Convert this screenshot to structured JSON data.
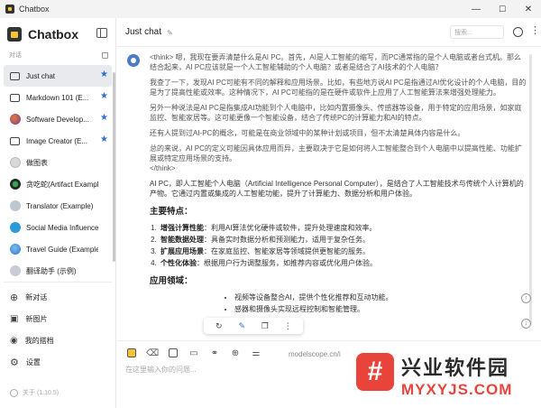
{
  "window": {
    "title": "Chatbox",
    "minimize": "—",
    "maximize": "☐",
    "close": "✕"
  },
  "sidebar": {
    "brand": "Chatbox",
    "section_label": "对话",
    "chats": [
      {
        "label": "Just chat",
        "starred": true,
        "icon": "chat-bubble-icon"
      },
      {
        "label": "Markdown 101 (E...",
        "starred": true,
        "icon": "chat-bubble-icon"
      },
      {
        "label": "Software Develop...",
        "starred": true,
        "icon": "avatar-icon"
      },
      {
        "label": "Image Creator (E...",
        "starred": true,
        "icon": "chat-bubble-icon"
      },
      {
        "label": "做图表",
        "starred": false,
        "icon": "avatar-icon"
      },
      {
        "label": "贪吃蛇(Artifact Example)",
        "starred": false,
        "icon": "avatar-icon"
      },
      {
        "label": "Translator (Example)",
        "starred": false,
        "icon": "avatar-icon"
      },
      {
        "label": "Social Media Influence...",
        "starred": false,
        "icon": "avatar-icon"
      },
      {
        "label": "Travel Guide (Example)",
        "starred": false,
        "icon": "avatar-icon"
      },
      {
        "label": "翻译助手 (示例)",
        "starred": false,
        "icon": "avatar-icon"
      }
    ],
    "menu": [
      {
        "label": "新对话",
        "icon": "plus-circle-icon"
      },
      {
        "label": "新图片",
        "icon": "image-icon"
      },
      {
        "label": "我的搭档",
        "icon": "partner-icon"
      },
      {
        "label": "设置",
        "icon": "gear-icon"
      }
    ],
    "version": "关于 (1.10.5)"
  },
  "header": {
    "title": "Just chat",
    "search_placeholder": "搜索..."
  },
  "message": {
    "think_paragraphs": [
      "<think> 嗯，我现在要弄清楚什么是AI PC。首先，AI是人工智能的缩写，而PC通常指的是个人电脑或者台式机。那么结合起来，AI PC应该就是一个人工智能辅助的个人电脑？或者是结合了AI技术的个人电脑？",
      "我查了一下，发现AI PC可能有不同的解释和应用场景。比如，有些地方说AI PC是指通过AI优化设计的个人电脑，目的是为了提高性能或效率。这种情况下，AI PC可能指的是在硬件或软件上应用了人工智能算法来增强处理能力。",
      "另外一种说法是AI PC是指集成AI功能到个人电脑中，比如内置摄像头、传感器等设备，用于特定的应用场景，如家庭监控、智能家居等。这可能更像一个智能设备，结合了传统PC的计算能力和AI的特点。",
      "还有人提到过AI-PC的概念，可能是在商业领域中的某种计划或项目，但不太清楚具体内容是什么。",
      "总的来说，AI PC的定义可能因具体应用而异，主要取决于它是如何将人工智能整合到个人电脑中以提高性能、功能扩展或特定应用场景的支持。",
      "</think>"
    ],
    "answer": "AI PC，即人工智能个人电脑（Artificial Intelligence Personal Computer），是结合了人工智能技术与传统个人计算机的产物。它通过内置或集成的人工智能功能，提升了计算能力、数据分析和用户体验。",
    "features_heading": "主要特点：",
    "features": [
      {
        "bold": "增强计算性能",
        "text": "：利用AI算法优化硬件或软件，提升处理速度和效率。"
      },
      {
        "bold": "智能数据处理",
        "text": "：具备实时数据分析和预测能力，适用于复杂任务。"
      },
      {
        "bold": "扩展应用场景",
        "text": "：在家庭监控、智能家居等领域提供更智能的服务。"
      },
      {
        "bold": "个性化体验",
        "text": "：根据用户行为调整服务，如推荐内容或优化用户体验。"
      }
    ],
    "apps_heading": "应用领域：",
    "apps": [
      "视频等设备整合AI，提供个性化推荐和互动功能。",
      "感器和摄像头实现远程控制和智能管理。"
    ]
  },
  "composer": {
    "placeholder": "在这里输入你的问题...",
    "watermark": "modelscope.cn/i"
  },
  "overlay": {
    "cn": "兴业软件园",
    "en": "MYXYJS.COM",
    "logo_char": "#"
  },
  "colors": {
    "accent": "#2f6fd4",
    "overlay_red": "#e8443b"
  }
}
